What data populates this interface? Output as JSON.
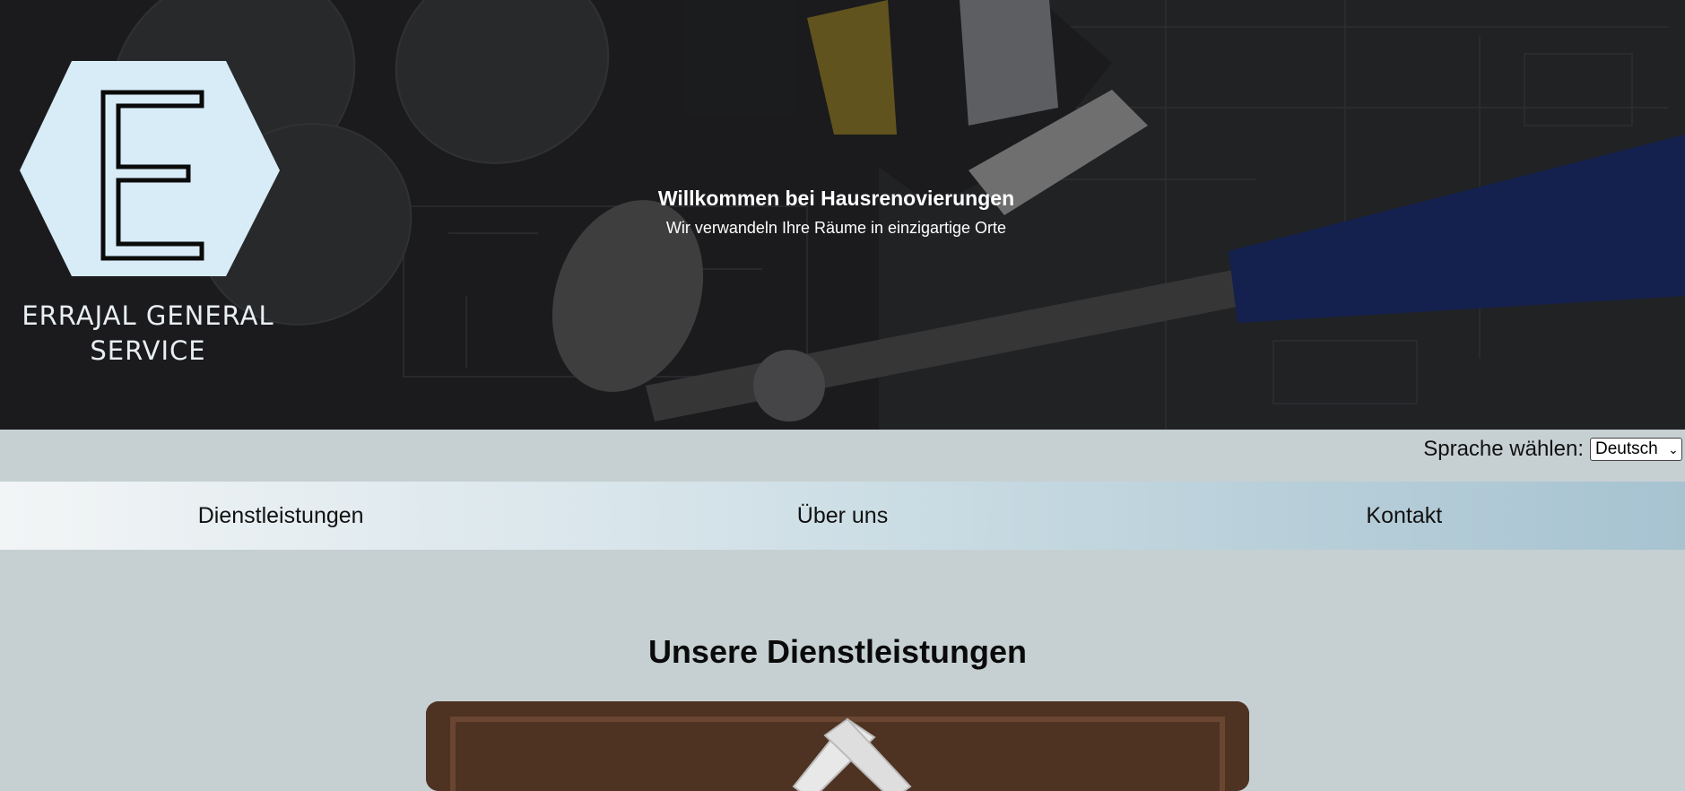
{
  "hero": {
    "logo_line1": "ERRAJAL GENERAL",
    "logo_line2": "SERVICE",
    "logo_letter": "E",
    "title": "Willkommen bei Hausrenovierungen",
    "subtitle": "Wir verwandeln Ihre Räume in einzigartige Orte"
  },
  "language": {
    "label": "Sprache wählen:",
    "selected": "Deutsch"
  },
  "nav": {
    "items": [
      {
        "label": "Dienstleistungen"
      },
      {
        "label": "Über uns"
      },
      {
        "label": "Kontakt"
      }
    ]
  },
  "main": {
    "services_title": "Unsere Dienstleistungen"
  },
  "colors": {
    "page_bg": "#c6d0d2",
    "logo_hex": "#d8ecf8",
    "hammer_handle": "#1e3a9a"
  }
}
